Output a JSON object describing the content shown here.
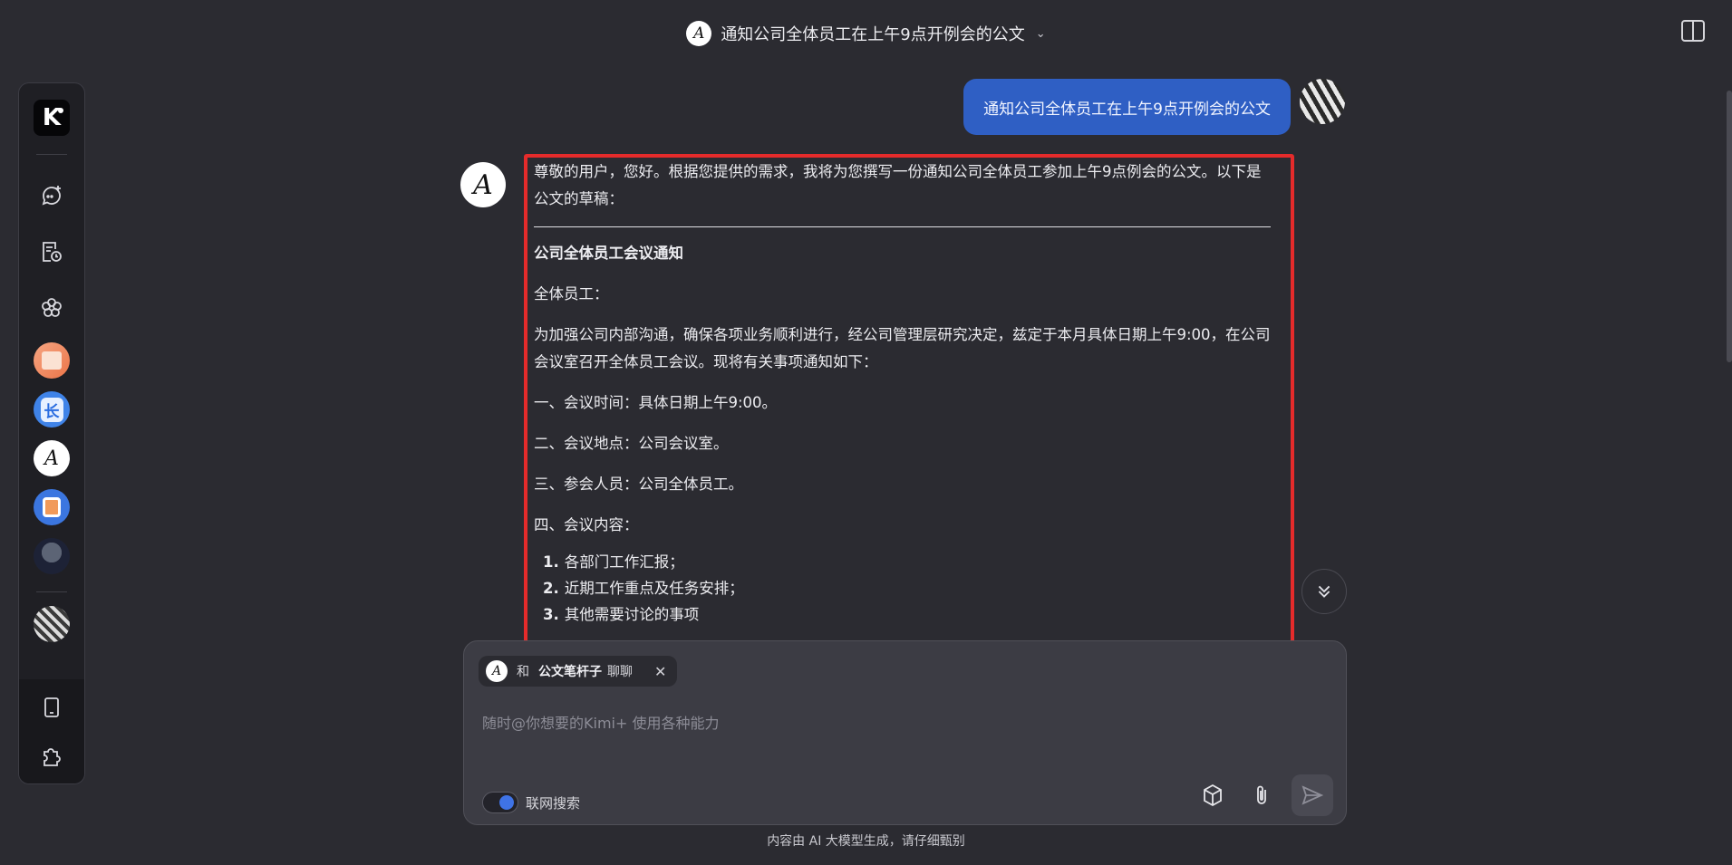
{
  "header": {
    "title": "通知公司全体员工在上午9点开例会的公文",
    "bot_avatar_glyph": "A"
  },
  "sidebar": {
    "logo_text": "K",
    "icons": [
      "new-chat-icon",
      "history-icon",
      "explore-icon"
    ],
    "avatars": [
      "orange-app",
      "长",
      "A",
      "travel-app",
      "person",
      "user"
    ],
    "bottom_icons": [
      "tablet-icon",
      "plugin-icon"
    ]
  },
  "chat": {
    "user_message": "通知公司全体员工在上午9点开例会的公文",
    "answer": {
      "intro": "尊敬的用户，您好。根据您提供的需求，我将为您撰写一份通知公司全体员工参加上午9点例会的公文。以下是公文的草稿：",
      "doc_title": "公司全体员工会议通知",
      "salutation": "全体员工：",
      "body": "为加强公司内部沟通，确保各项业务顺利进行，经公司管理层研究决定，兹定于本月具体日期上午9:00，在公司会议室召开全体员工会议。现将有关事项通知如下：",
      "item1": "一、会议时间：具体日期上午9:00。",
      "item2": "二、会议地点：公司会议室。",
      "item3": "三、参会人员：公司全体员工。",
      "item4": "四、会议内容：",
      "list": [
        {
          "num": "1.",
          "text": "各部门工作汇报；"
        },
        {
          "num": "2.",
          "text": "近期工作重点及任务安排；"
        },
        {
          "num": "3.",
          "text": "其他需要讨论的事项"
        }
      ]
    }
  },
  "composer": {
    "chip_prefix": "和",
    "chip_bot": "公文笔杆子",
    "chip_suffix": "聊聊",
    "placeholder": "随时@你想要的Kimi+ 使用各种能力",
    "web_search_label": "联网搜索",
    "web_search_on": true
  },
  "footer": "内容由 AI 大模型生成，请仔细甄别",
  "colors": {
    "background": "#2b2b31",
    "user_bubble": "#2f5fc4",
    "highlight": "#e52b2b"
  }
}
